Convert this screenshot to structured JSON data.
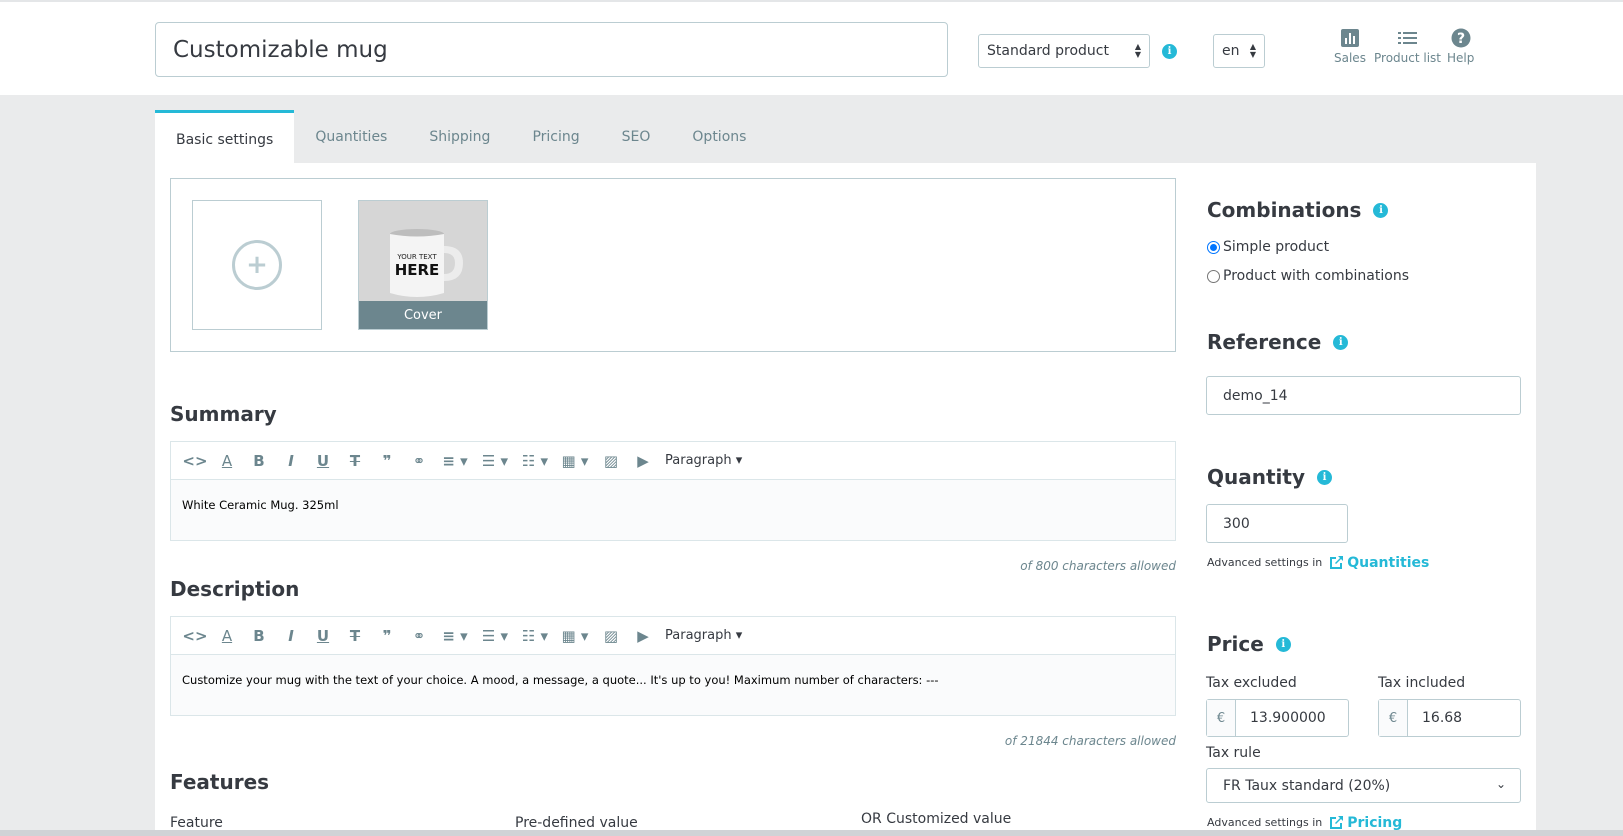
{
  "header": {
    "product_name": "Customizable mug",
    "product_type": "Standard product",
    "language": "en",
    "tools": [
      {
        "label": "Sales",
        "icon": "bar-chart-icon"
      },
      {
        "label": "Product list",
        "icon": "list-icon"
      },
      {
        "label": "Help",
        "icon": "help-icon"
      }
    ]
  },
  "tabs": [
    "Basic settings",
    "Quantities",
    "Shipping",
    "Pricing",
    "SEO",
    "Options"
  ],
  "images": {
    "cover_label": "Cover",
    "mug_text_line1": "YOUR TEXT",
    "mug_text_line2": "HERE"
  },
  "summary": {
    "title": "Summary",
    "paragraph_label": "Paragraph",
    "content": "White Ceramic Mug. 325ml",
    "char_count": "of 800 characters allowed"
  },
  "description": {
    "title": "Description",
    "paragraph_label": "Paragraph",
    "content": "Customize your mug with the text of your choice. A mood, a message, a quote... It's up to you! Maximum number of characters: ---",
    "char_count": "of 21844 characters allowed"
  },
  "features": {
    "title": "Features",
    "col_feature": "Feature",
    "col_predefined": "Pre-defined value",
    "col_custom": "OR Customized value"
  },
  "combinations": {
    "title": "Combinations",
    "option_simple": "Simple product",
    "option_combinations": "Product with combinations"
  },
  "reference": {
    "title": "Reference",
    "value": "demo_14"
  },
  "quantity": {
    "title": "Quantity",
    "value": "300",
    "advanced_text": "Advanced settings in",
    "advanced_link": "Quantities"
  },
  "price": {
    "title": "Price",
    "tax_excluded_label": "Tax excluded",
    "tax_included_label": "Tax included",
    "currency": "€",
    "tax_excluded_value": "13.900000",
    "tax_included_value": "16.68",
    "tax_rule_label": "Tax rule",
    "tax_rule_value": "FR Taux standard (20%)",
    "advanced_text": "Advanced settings in",
    "advanced_link": "Pricing"
  },
  "colors": {
    "accent": "#25b9d7",
    "text": "#363a41",
    "muted": "#6c868e",
    "border": "#bbcdd2"
  }
}
